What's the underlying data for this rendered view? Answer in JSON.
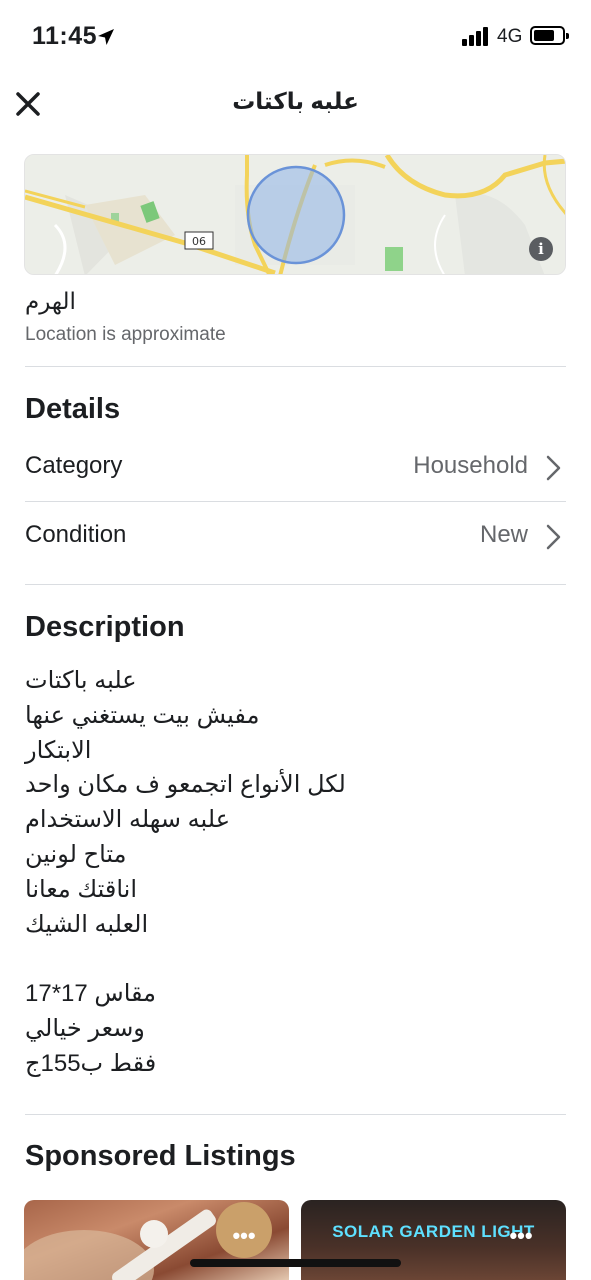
{
  "status_bar": {
    "time": "11:45",
    "network": "4G"
  },
  "header": {
    "title": "علبه باكتات"
  },
  "map": {
    "road_label": "06",
    "info_label": "i"
  },
  "location": {
    "name": "الهرم",
    "note": "Location is approximate"
  },
  "details": {
    "title": "Details",
    "rows": [
      {
        "label": "Category",
        "value": "Household"
      },
      {
        "label": "Condition",
        "value": "New"
      }
    ]
  },
  "description": {
    "title": "Description",
    "lines": [
      "علبه باكتات",
      "مفيش بيت يستغني عنها",
      "الابتكار",
      "لكل الأنواع اتجمعو ف مكان واحد",
      "علبه سهله الاستخدام",
      "متاح لونين",
      "اناقتك معانا",
      "العلبه الشيك",
      "",
      "مقاس 17*17",
      "وسعر خيالي",
      "فقط ب155ج"
    ]
  },
  "sponsored": {
    "title": "Sponsored Listings",
    "cards": [
      {
        "caption": "",
        "more": "•••"
      },
      {
        "caption": "SOLAR GARDEN LIGHT",
        "more": "•••"
      }
    ]
  }
}
